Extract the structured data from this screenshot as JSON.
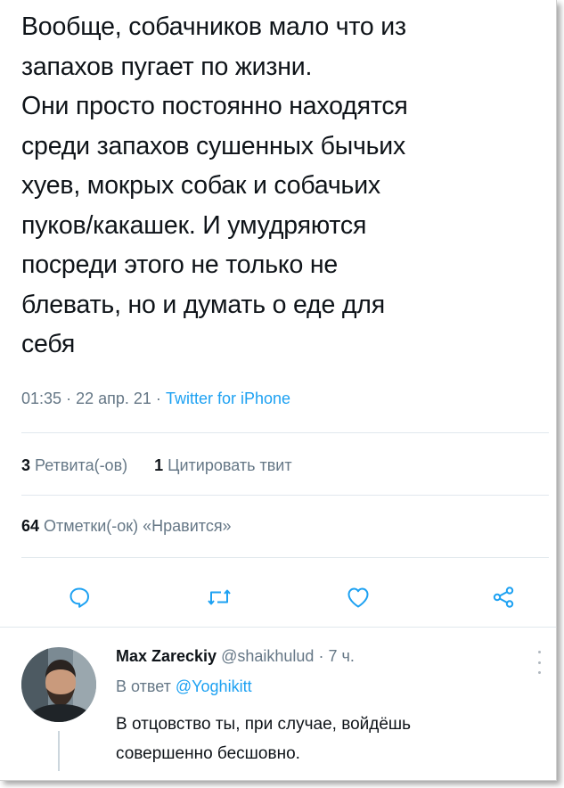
{
  "tweet": {
    "text": "Вообще, собачников мало что из\nзапахов пугает по жизни.\nОни просто постоянно находятся\nсреди запахов сушенных бычьих\nхуев, мокрых собак и собачьих\nпуков/какашек. И умудряются\nпосреди этого не только не\nблевать, но и думать о еде для\nсебя",
    "time": "01:35",
    "separator": "·",
    "date": "22 апр. 21",
    "source": "Twitter for iPhone"
  },
  "stats": {
    "retweets_count": "3",
    "retweets_label": "Ретвита(-ов)",
    "quotes_count": "1",
    "quotes_label": "Цитировать твит",
    "likes_count": "64",
    "likes_label": "Отметки(-ок) «Нравится»"
  },
  "icons": {
    "reply": "reply-icon",
    "retweet": "retweet-icon",
    "like": "heart-icon",
    "share": "share-icon",
    "more": "more-icon"
  },
  "reply": {
    "name": "Max Zareckiy",
    "handle": "@shaikhulud",
    "separator": "·",
    "time": "7 ч.",
    "reply_to_label": "В ответ",
    "reply_to_mention": "@Yoghikitt",
    "text": "В отцовство ты, при случае, войдёшь\nсовершенно бесшовно."
  },
  "colors": {
    "accent": "#1da1f2",
    "secondary_text": "#657786",
    "primary_text": "#0f1419",
    "divider": "#e1e8ed"
  }
}
